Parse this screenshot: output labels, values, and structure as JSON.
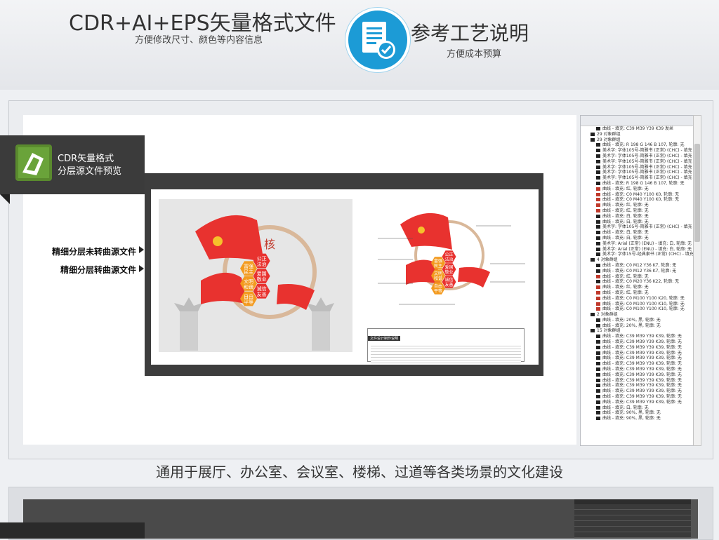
{
  "header": {
    "format_title": "CDR+AI+EPS矢量格式文件",
    "format_subtitle": "方便修改尺寸、颜色等内容信息",
    "craft_title": "参考工艺说明",
    "craft_subtitle": "方便成本预算"
  },
  "preview": {
    "banner_line1": "CDR矢量格式",
    "banner_line2": "分层源文件预览",
    "label_uncurved": "精细分层未转曲源文件",
    "label_curved": "精细分层转曲源文件"
  },
  "artwork": {
    "chars": [
      "公正",
      "法治",
      "富强",
      "民主",
      "爱国",
      "敬业",
      "文明",
      "和谐",
      "诚信",
      "友善",
      "自由",
      "平等"
    ],
    "callout_title": "文件设计制作说明"
  },
  "object_tree": {
    "rows": [
      "曲线 - 填充: C39 M39 Y39 K39 发丝",
      "29 对象群组",
      "29 对象群组",
      "曲线 - 填充: R 198 G 146 B 107, 轮廓: 无",
      "美术字: 字体105号-简雅书 (正常) (CHC) - 填充",
      "美术字: 字体105号-简雅书 (正常) (CHC) - 填充",
      "美术字: 字体105号-简雅书 (正常) (CHC) - 填充",
      "美术字: 字体105号-简雅书 (正常) (CHC) - 填充",
      "美术字: 字体105号-简雅书 (正常) (CHC) - 填充",
      "美术字: 字体105号-简雅书 (正常) (CHC) - 填充",
      "曲线 - 填充: R 198 G 146 B 107, 轮廓: 无",
      "曲线 - 填充: 红, 轮廓: 无",
      "曲线 - 填充: C0 M40 Y100 K0, 轮廓: 无",
      "曲线 - 填充: C0 M40 Y100 K0, 轮廓: 无",
      "曲线 - 填充: 红, 轮廓: 无",
      "曲线 - 填充: 红, 轮廓: 无",
      "曲线 - 填充: 白, 轮廓: 无",
      "曲线 - 填充: 白, 轮廓: 无",
      "美术字: 字体105号-简雅书 (正常) (CHC) - 填充",
      "曲线 - 填充: 白, 轮廓: 无",
      "曲线 - 填充: 白, 轮廓: 无",
      "美术字: Arial (正常) (ENU) - 填充: 白, 轮廓: 无",
      "美术字: Arial (正常) (ENU) - 填充: 白, 轮廓: 无",
      "美术字: 字体15号-经典隶书 (正常) (CHC) - 填充",
      "4 对象群组",
      "曲线 - 填充: C0 M12 Y36 K7, 轮廓: 无",
      "曲线 - 填充: C0 M12 Y36 K7, 轮廓: 无",
      "曲线 - 填充: 红, 轮廓: 无",
      "曲线 - 填充: C0 M20 Y36 K22, 轮廓: 无",
      "曲线 - 填充: 红, 轮廓: 无",
      "曲线 - 填充: 红, 轮廓: 无",
      "曲线 - 填充: C0 M100 Y100 K20, 轮廓: 无",
      "曲线 - 填充: C0 M100 Y100 K10, 轮廓: 无",
      "曲线 - 填充: C0 M100 Y100 K10, 轮廓: 无",
      "2 对象群组",
      "曲线 - 填充: 20%, 黑, 轮廓: 无",
      "曲线 - 填充: 20%, 黑, 轮廓: 无",
      "15 对象群组",
      "曲线 - 填充: C39 M39 Y39 K39, 轮廓: 无",
      "曲线 - 填充: C39 M39 Y39 K39, 轮廓: 无",
      "曲线 - 填充: C39 M39 Y39 K39, 轮廓: 无",
      "曲线 - 填充: C39 M39 Y39 K39, 轮廓: 无",
      "曲线 - 填充: C39 M39 Y39 K39, 轮廓: 无",
      "曲线 - 填充: C39 M39 Y39 K39, 轮廓: 无",
      "曲线 - 填充: C39 M39 Y39 K39, 轮廓: 无",
      "曲线 - 填充: C39 M39 Y39 K39, 轮廓: 无",
      "曲线 - 填充: C39 M39 Y39 K39, 轮廓: 无",
      "曲线 - 填充: C39 M39 Y39 K39, 轮廓: 无",
      "曲线 - 填充: C39 M39 Y39 K39, 轮廓: 无",
      "曲线 - 填充: C39 M39 Y39 K39, 轮廓: 无",
      "曲线 - 填充: C39 M39 Y39 K39, 轮廓: 无",
      "曲线 - 填充: 白, 轮廓: 无",
      "曲线 - 填充: 90%, 黑, 轮廓: 无",
      "曲线 - 填充: 90%, 黑, 轮廓: 无"
    ]
  },
  "footer": {
    "usage_text": "通用于展厅、办公室、会议室、楼梯、过道等各类场景的文化建设"
  },
  "icons": {
    "doc": "document-check-icon",
    "cdr_logo": "coreldraw-logo-icon",
    "arrow": "triangle-right-icon"
  },
  "colors": {
    "accent_blue": "#1c9bd6",
    "flag_red": "#e8322f",
    "hex_orange": "#f39a1e"
  }
}
